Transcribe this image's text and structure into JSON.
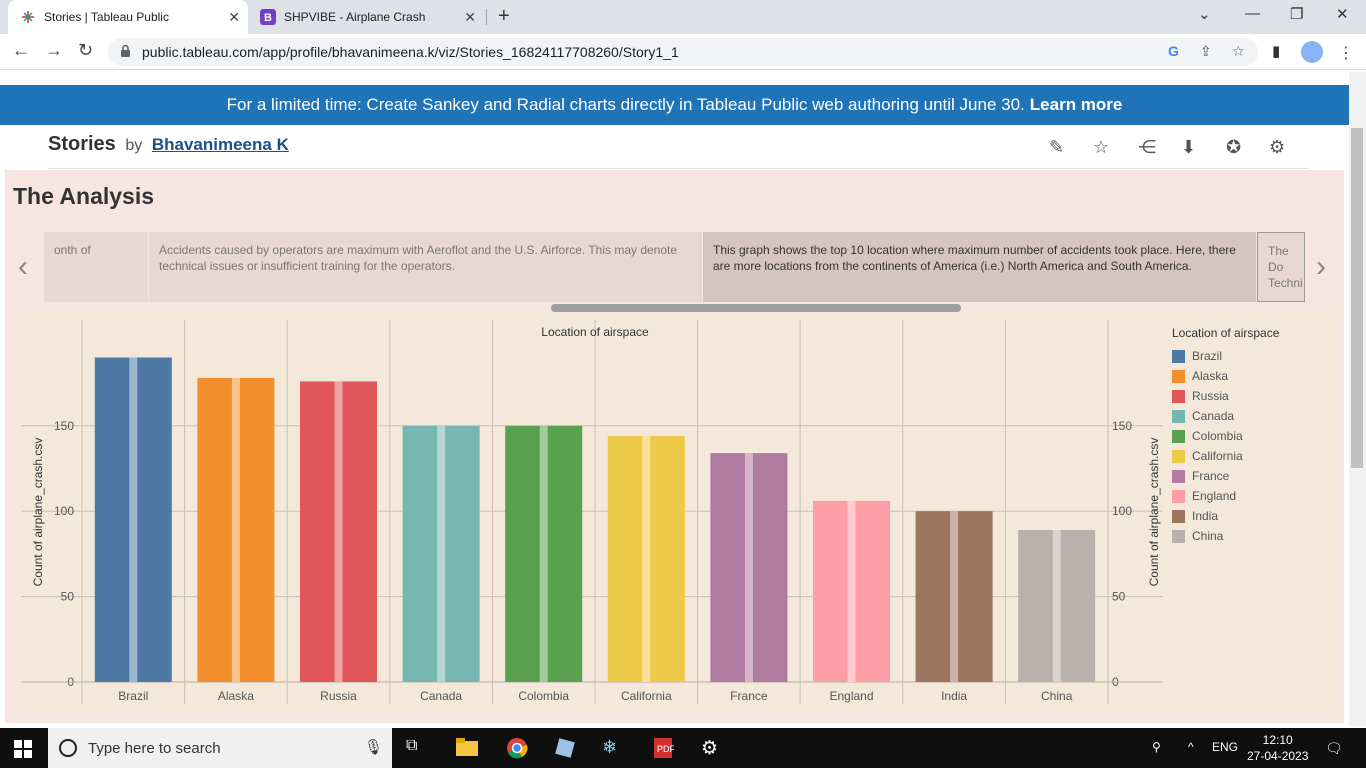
{
  "browser": {
    "tabs": [
      {
        "title": "Stories | Tableau Public",
        "active": true
      },
      {
        "title": "SHPVIBE - Airplane Crash",
        "active": false
      }
    ],
    "url": "public.tableau.com/app/profile/bhavanimeena.k/viz/Stories_16824117708260/Story1_1"
  },
  "promo": {
    "text": "For a limited time: Create Sankey and Radial charts directly in Tableau Public web authoring until June 30.",
    "link": "Learn more"
  },
  "viz": {
    "title": "Stories",
    "by": "by",
    "author": "Bhavanimeena K"
  },
  "story": {
    "title": "The Analysis",
    "points": [
      {
        "text": "onth of"
      },
      {
        "text": "Accidents caused by operators are maximum with Aeroflot and the U.S. Airforce. This may denote technical issues or insufficient training for the operators."
      },
      {
        "text": "This graph shows the top 10 location where maximum number of accidents took place. Here, there are more locations from the continents of America (i.e.) North America and South America."
      },
      {
        "text": "The Do Techni"
      }
    ]
  },
  "chart_data": {
    "type": "bar",
    "title": "Location of airspace",
    "ylabel": "Count of airplane_crash.csv",
    "categories": [
      "Brazil",
      "Alaska",
      "Russia",
      "Canada",
      "Colombia",
      "California",
      "France",
      "England",
      "India",
      "China"
    ],
    "values": [
      190,
      178,
      176,
      150,
      150,
      144,
      134,
      106,
      100,
      89
    ],
    "colors": [
      "#4e79a7",
      "#f28e2b",
      "#e15759",
      "#76b7b2",
      "#59a14f",
      "#edc948",
      "#b07aa1",
      "#ff9da7",
      "#9c755f",
      "#bab0ac"
    ],
    "yticks": [
      0,
      50,
      100,
      150
    ],
    "ylim": [
      0,
      200
    ],
    "legend_title": "Location of airspace",
    "legend_position": "right",
    "grid": true
  },
  "taskbar": {
    "search_placeholder": "Type here to search",
    "language": "ENG",
    "time": "12:10",
    "date": "27-04-2023"
  }
}
